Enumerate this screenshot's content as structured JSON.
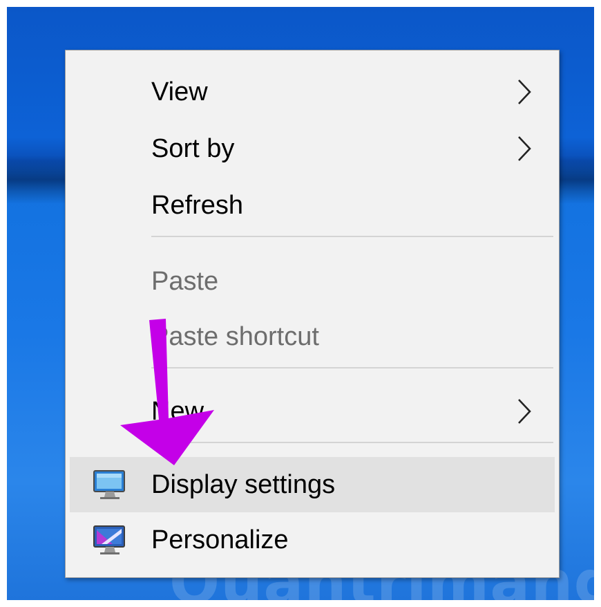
{
  "menu": {
    "items": [
      {
        "label": "View",
        "has_submenu": true,
        "enabled": true,
        "icon": ""
      },
      {
        "label": "Sort by",
        "has_submenu": true,
        "enabled": true,
        "icon": ""
      },
      {
        "label": "Refresh",
        "has_submenu": false,
        "enabled": true,
        "icon": ""
      },
      {
        "label": "Paste",
        "has_submenu": false,
        "enabled": false,
        "icon": ""
      },
      {
        "label": "Paste shortcut",
        "has_submenu": false,
        "enabled": false,
        "icon": ""
      },
      {
        "label": "New",
        "has_submenu": true,
        "enabled": true,
        "icon": ""
      },
      {
        "label": "Display settings",
        "has_submenu": false,
        "enabled": true,
        "highlighted": true,
        "icon": "display-settings-icon"
      },
      {
        "label": "Personalize",
        "has_submenu": false,
        "enabled": true,
        "icon": "personalize-icon"
      }
    ]
  },
  "annotation": {
    "arrow_color": "#c400e8"
  },
  "colors": {
    "menu_background": "#f2f2f2",
    "highlight": "#e1e1e1",
    "disabled_text": "#6d6d6d",
    "desktop_blue": "#1372e0"
  },
  "watermark": {
    "text": "Quantrimang"
  }
}
